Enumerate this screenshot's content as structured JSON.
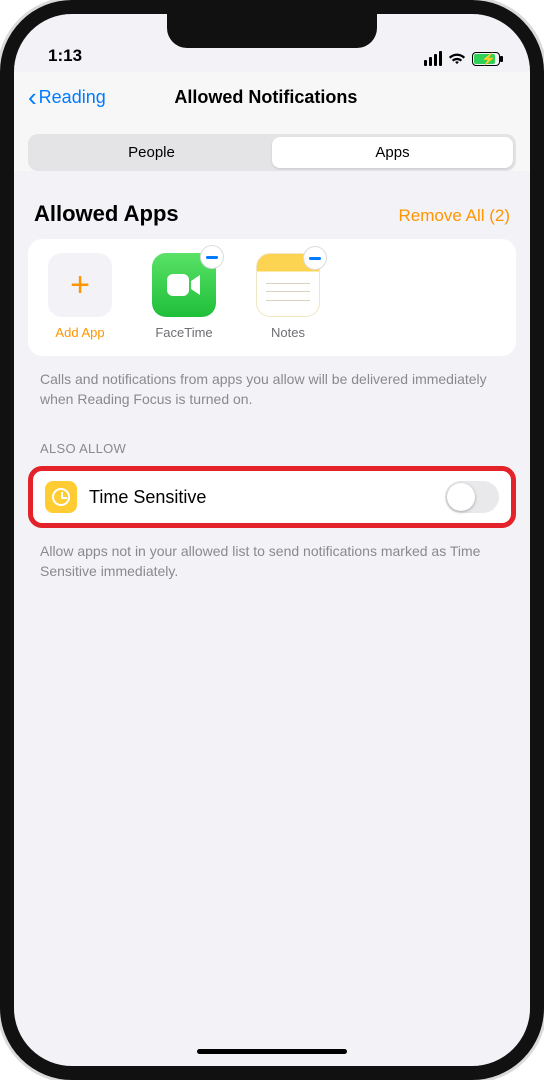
{
  "status": {
    "time": "1:13"
  },
  "nav": {
    "back": "Reading",
    "title": "Allowed Notifications"
  },
  "seg": {
    "people": "People",
    "apps": "Apps",
    "active": "apps"
  },
  "allowed": {
    "header": "Allowed Apps",
    "remove_all": "Remove All (2)",
    "add_label": "Add App",
    "apps": [
      {
        "label": "FaceTime"
      },
      {
        "label": "Notes"
      }
    ],
    "footer": "Calls and notifications from apps you allow will be delivered immediately when Reading Focus is turned on."
  },
  "also_allow": {
    "header": "ALSO ALLOW",
    "time_sensitive_label": "Time Sensitive",
    "time_sensitive_on": false,
    "footer": "Allow apps not in your allowed list to send notifications marked as Time Sensitive immediately."
  }
}
